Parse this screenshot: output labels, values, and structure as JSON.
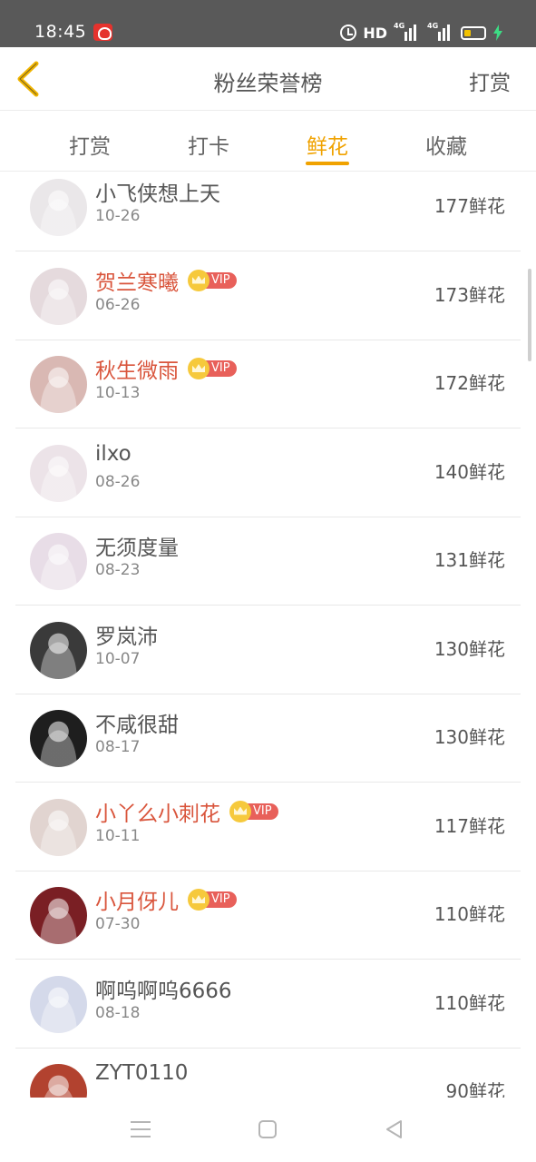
{
  "status_bar": {
    "time": "18:45",
    "hd": "HD",
    "network_1": "4G",
    "network_2": "4G"
  },
  "header": {
    "title": "粉丝荣誉榜",
    "action_label": "打赏"
  },
  "tabs": [
    {
      "label": "打赏",
      "active": false
    },
    {
      "label": "打卡",
      "active": false
    },
    {
      "label": "鲜花",
      "active": true
    },
    {
      "label": "收藏",
      "active": false
    }
  ],
  "vip_label": "VIP",
  "fans": [
    {
      "name": "小飞侠想上天",
      "date": "10-26",
      "amount": "177鲜花",
      "vip": false,
      "avatar_color": "#eae7e9"
    },
    {
      "name": "贺兰寒曦",
      "date": "06-26",
      "amount": "173鲜花",
      "vip": true,
      "avatar_color": "#e5dadd"
    },
    {
      "name": "秋生微雨",
      "date": "10-13",
      "amount": "172鲜花",
      "vip": true,
      "avatar_color": "#d9b8b3"
    },
    {
      "name": "ilxo",
      "date": "08-26",
      "amount": "140鲜花",
      "vip": false,
      "avatar_color": "#ece3e8"
    },
    {
      "name": "无须度量",
      "date": "08-23",
      "amount": "131鲜花",
      "vip": false,
      "avatar_color": "#e8dde7"
    },
    {
      "name": "罗岚沛",
      "date": "10-07",
      "amount": "130鲜花",
      "vip": false,
      "avatar_color": "#3a3a3a"
    },
    {
      "name": "不咸很甜",
      "date": "08-17",
      "amount": "130鲜花",
      "vip": false,
      "avatar_color": "#1e1e1e"
    },
    {
      "name": "小丫么小刺花",
      "date": "10-11",
      "amount": "117鲜花",
      "vip": true,
      "avatar_color": "#e1d4d0"
    },
    {
      "name": "小月伢儿",
      "date": "07-30",
      "amount": "110鲜花",
      "vip": true,
      "avatar_color": "#7a1f24"
    },
    {
      "name": "啊呜啊呜6666",
      "date": "08-18",
      "amount": "110鲜花",
      "vip": false,
      "avatar_color": "#d4d9ea"
    },
    {
      "name": "ZYT0110",
      "date": "",
      "amount": "90鲜花",
      "vip": false,
      "avatar_color": "#b2422f"
    }
  ]
}
